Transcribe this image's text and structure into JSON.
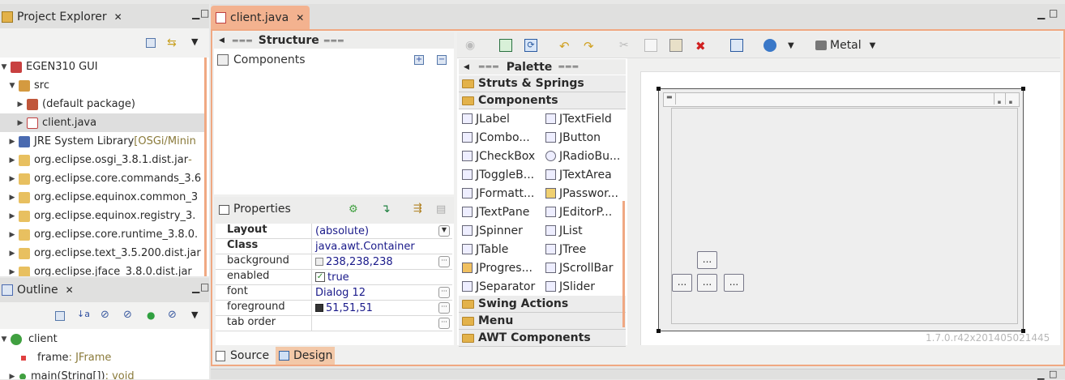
{
  "project_explorer": {
    "title": "Project Explorer",
    "items": [
      {
        "label": "EGEN310 GUI",
        "extra": ""
      },
      {
        "label": "src",
        "extra": ""
      },
      {
        "label": "(default package)",
        "extra": ""
      },
      {
        "label": "client.java",
        "extra": ""
      },
      {
        "label": "JRE System Library",
        "extra": "[OSGi/Minin"
      },
      {
        "label": "org.eclipse.osgi_3.8.1.dist.jar",
        "extra": " - "
      },
      {
        "label": "org.eclipse.core.commands_3.6",
        "extra": ""
      },
      {
        "label": "org.eclipse.equinox.common_3",
        "extra": ""
      },
      {
        "label": "org.eclipse.equinox.registry_3.",
        "extra": ""
      },
      {
        "label": "org.eclipse.core.runtime_3.8.0.",
        "extra": ""
      },
      {
        "label": "org.eclipse.text_3.5.200.dist.jar",
        "extra": ""
      },
      {
        "label": "org.eclipse.jface_3.8.0.dist.jar",
        "extra": ""
      }
    ]
  },
  "outline": {
    "title": "Outline",
    "items": [
      {
        "label": "client",
        "type": ""
      },
      {
        "label": "frame",
        "type": " : JFrame"
      },
      {
        "label": "main(String[])",
        "type": " : void"
      }
    ]
  },
  "editor": {
    "tab_title": "client.java",
    "structure_title": "Structure",
    "components_label": "Components",
    "properties_label": "Properties",
    "properties": [
      {
        "key": "Layout",
        "value": "(absolute)",
        "bold": true
      },
      {
        "key": "Class",
        "value": "java.awt.Container",
        "bold": true
      },
      {
        "key": "background",
        "value": "238,238,238",
        "bold": false
      },
      {
        "key": "enabled",
        "value": "true",
        "bold": false
      },
      {
        "key": "font",
        "value": "Dialog 12",
        "bold": false
      },
      {
        "key": "foreground",
        "value": "51,51,51",
        "bold": false
      },
      {
        "key": "tab order",
        "value": "",
        "bold": false
      }
    ],
    "bottom_tabs": {
      "source": "Source",
      "design": "Design"
    },
    "toolbar": {
      "look_and_feel": "Metal"
    },
    "palette": {
      "title": "Palette",
      "categories": {
        "struts": "Struts & Springs",
        "components": "Components",
        "swing_actions": "Swing Actions",
        "menu": "Menu",
        "awt": "AWT Components"
      },
      "items": [
        "JLabel",
        "JTextField",
        "JCombo...",
        "JButton",
        "JCheckBox",
        "JRadioBu...",
        "JToggleB...",
        "JTextArea",
        "JFormatt...",
        "JPasswor...",
        "JTextPane",
        "JEditorP...",
        "JSpinner",
        "JList",
        "JTable",
        "JTree",
        "JProgres...",
        "JScrollBar",
        "JSeparator",
        "JSlider"
      ]
    },
    "canvas": {
      "dot_button": "...",
      "version": "1.7.0.r42x201405021445"
    }
  },
  "colors": {
    "accent": "#f0a882",
    "tab_active": "#f3b28f",
    "canvas_bg": "#eeeeee"
  }
}
